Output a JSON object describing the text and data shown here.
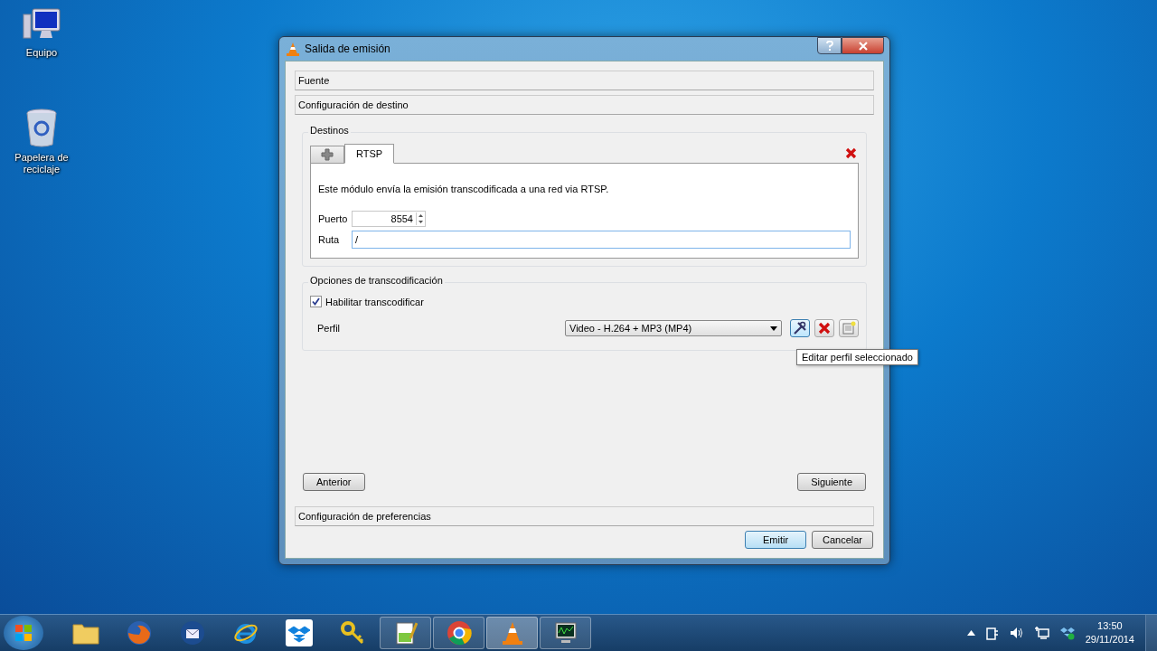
{
  "desktop_icons": [
    {
      "label": "Equipo",
      "kind": "computer"
    },
    {
      "label": "Papelera de reciclaje",
      "kind": "recycle"
    }
  ],
  "dialog": {
    "title": "Salida de emisión",
    "top_sections": [
      "Fuente",
      "Configuración de destino"
    ],
    "destinations": {
      "legend": "Destinos",
      "tabs": [
        {
          "label": "RTSP",
          "selected": true
        }
      ],
      "description": "Este módulo envía la emisión transcodificada a una red via RTSP.",
      "port_label": "Puerto",
      "port_value": "8554",
      "path_label": "Ruta",
      "path_value": "/"
    },
    "transcoding": {
      "legend": "Opciones de transcodificación",
      "enable_label": "Habilitar transcodificar",
      "enabled": true,
      "profile_label": "Perfil",
      "profile_value": "Video - H.264 + MP3 (MP4)"
    },
    "tooltip": "Editar perfil seleccionado",
    "nav_buttons": [
      "Anterior",
      "Siguiente"
    ],
    "bottom_section": "Configuración de preferencias",
    "buttons": [
      {
        "label": "Emitir",
        "default": true
      },
      {
        "label": "Cancelar",
        "default": false
      }
    ]
  },
  "taskbar": {
    "apps": [
      {
        "kind": "explorer",
        "open": false,
        "active": false
      },
      {
        "kind": "firefox",
        "open": false,
        "active": false
      },
      {
        "kind": "mail",
        "open": false,
        "active": false
      },
      {
        "kind": "ie",
        "open": false,
        "active": false
      },
      {
        "kind": "dropbox",
        "open": false,
        "active": false
      },
      {
        "kind": "key",
        "open": false,
        "active": false
      },
      {
        "kind": "notepad",
        "open": true,
        "active": false
      },
      {
        "kind": "chrome",
        "open": true,
        "active": false
      },
      {
        "kind": "vlc",
        "open": true,
        "active": true
      },
      {
        "kind": "monitor",
        "open": true,
        "active": false
      }
    ],
    "time": "13:50",
    "date": "29/11/2014"
  }
}
